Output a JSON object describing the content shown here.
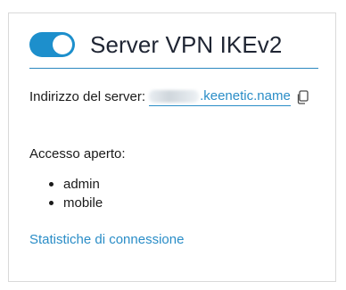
{
  "card": {
    "title": "Server VPN IKEv2",
    "toggle_state": "on",
    "server_label": "Indirizzo del server:",
    "server_value": ".keenetic.name",
    "access_label": "Accesso aperto:",
    "users": [
      "admin",
      "mobile"
    ],
    "stats_link": "Statistiche di connessione"
  },
  "colors": {
    "accent": "#1d8fcc",
    "link": "#2a8dc7"
  },
  "icons": {
    "copy": "copy-icon"
  }
}
